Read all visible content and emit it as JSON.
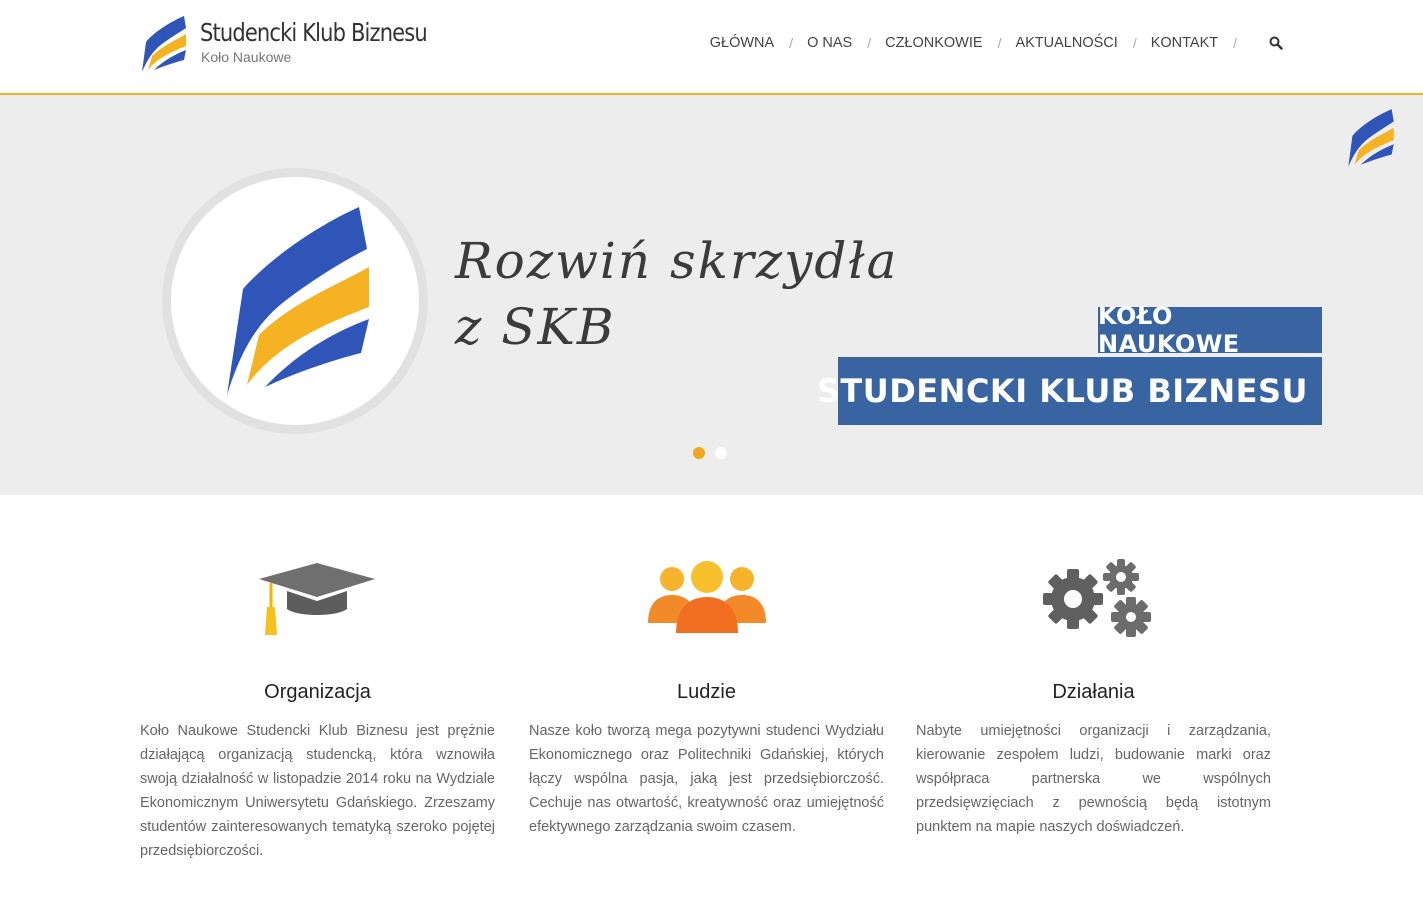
{
  "brand": {
    "title": "Studencki Klub Biznesu",
    "subtitle": "Koło Naukowe",
    "colors": {
      "blue": "#2f55b8",
      "yellow": "#f5b323",
      "accent_line": "#f0b02e",
      "badge_blue": "#3865a2"
    }
  },
  "nav": {
    "items": [
      {
        "label": "GŁÓWNA"
      },
      {
        "label": "O NAS"
      },
      {
        "label": "CZŁONKOWIE"
      },
      {
        "label": "AKTUALNOŚCI"
      },
      {
        "label": "KONTAKT"
      }
    ],
    "separator": "/",
    "search_icon": "search-icon"
  },
  "hero": {
    "tagline_line1": "Rozwiń skrzydła",
    "tagline_line2": "z SKB",
    "badge_small": "KOŁO NAUKOWE",
    "badge_large": "STUDENCKI KLUB BIZNESU",
    "slides_total": 2,
    "active_slide": 1
  },
  "features": [
    {
      "icon": "graduation-cap-icon",
      "title": "Organizacja",
      "text": "Koło Naukowe Studencki Klub Biznesu jest prężnie działającą organizacją studencką, która wznowiła swoją działalność w listopadzie 2014 roku na Wydziale Ekonomicznym Uniwersytetu Gdańskiego. Zrzeszamy studentów zainteresowanych tematyką szeroko pojętej przedsiębiorczości."
    },
    {
      "icon": "people-icon",
      "title": "Ludzie",
      "text": "Nasze koło tworzą mega pozytywni studenci Wydziału Ekonomicznego oraz Politechniki Gdańskiej, których łączy wspólna pasja, jaką jest przedsiębiorczość. Cechuje nas otwartość, kreatywność oraz umiejętność efektywnego zarządzania swoim czasem."
    },
    {
      "icon": "gears-icon",
      "title": "Działania",
      "text": "Nabyte umiejętności organizacji i zarządzania, kierowanie zespołem ludzi, budowanie marki oraz współpraca partnerska we wspólnych przedsięwzięciach z pewnością będą istotnym punktem na mapie naszych doświadczeń."
    }
  ]
}
